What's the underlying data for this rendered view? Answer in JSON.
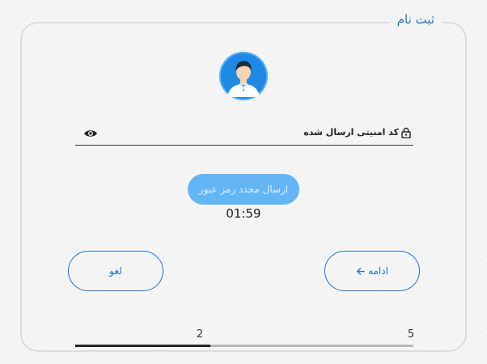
{
  "form": {
    "title": "ثبت نام"
  },
  "code_field": {
    "label": "کد امنیتی ارسال شده",
    "value": ""
  },
  "resend": {
    "label": "ارسال مجدد رمز عبور",
    "timer": "01:59",
    "disabled": true
  },
  "actions": {
    "continue_label": "ادامه",
    "cancel_label": "لغو"
  },
  "progress": {
    "current_label": "2",
    "total_label": "5",
    "fraction": 0.4
  },
  "icons": {
    "avatar": "user-avatar-icon",
    "lock": "lock-icon",
    "eye": "eye-icon",
    "arrow": "arrow-left-icon"
  },
  "colors": {
    "accent": "#1f72c4",
    "avatar_bg": "#1e88e5",
    "disabled_button": "#64b5f6",
    "progress_fill": "#222222",
    "progress_track": "#b8b8b8"
  }
}
